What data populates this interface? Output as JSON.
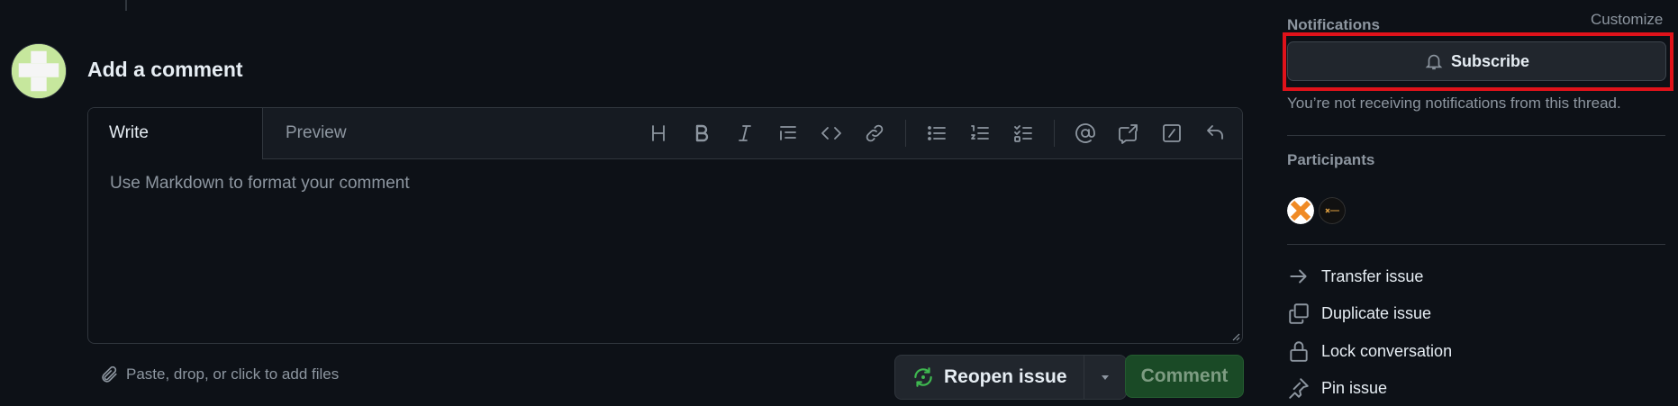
{
  "comment": {
    "title": "Add a comment",
    "tabs": {
      "write": "Write",
      "preview": "Preview"
    },
    "placeholder": "Use Markdown to format your comment",
    "attach_text": "Paste, drop, or click to add files",
    "reopen_label": "Reopen issue",
    "comment_label": "Comment",
    "toolbar_icons": [
      "heading-icon",
      "bold-icon",
      "italic-icon",
      "quote-icon",
      "code-icon",
      "link-icon",
      "unordered-list-icon",
      "ordered-list-icon",
      "task-list-icon",
      "mention-icon",
      "cross-reference-icon",
      "slash-commands-icon",
      "undo-icon"
    ]
  },
  "sidebar": {
    "notifications_label": "Notifications",
    "customize_label": "Customize",
    "subscribe_label": "Subscribe",
    "notif_text": "You’re not receiving notifications from this thread.",
    "participants_label": "Participants",
    "actions": [
      {
        "label": "Transfer issue",
        "icon": "arrow-right-icon"
      },
      {
        "label": "Duplicate issue",
        "icon": "duplicate-icon"
      },
      {
        "label": "Lock conversation",
        "icon": "lock-icon"
      },
      {
        "label": "Pin issue",
        "icon": "pin-icon"
      }
    ]
  },
  "colors": {
    "background": "#0d1117",
    "highlight": "#e0121a",
    "comment_button": "#1a4a26",
    "reopen_icon": "#3fb950"
  }
}
